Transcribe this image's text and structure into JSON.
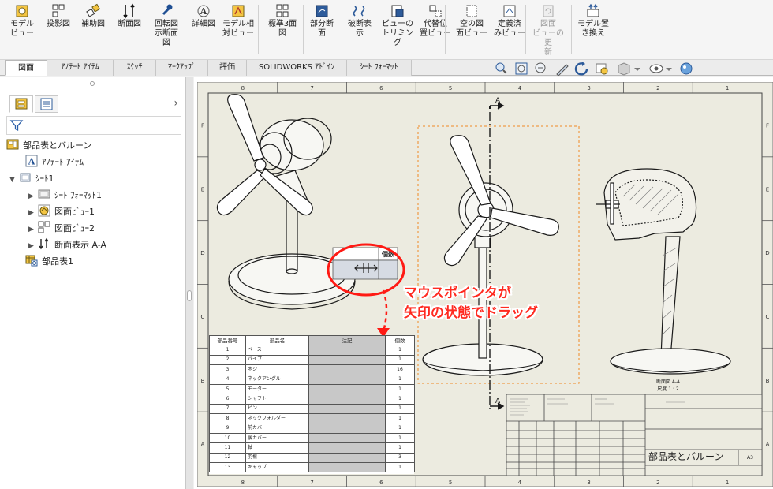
{
  "ribbon": {
    "buttons": [
      {
        "id": "model-view",
        "label": "モデル\nビュー",
        "icon": "model-view-icon",
        "disabled": false
      },
      {
        "id": "projected-view",
        "label": "投影図",
        "icon": "projected-view-icon",
        "disabled": false
      },
      {
        "id": "auxiliary-view",
        "label": "補助図",
        "icon": "auxiliary-view-icon",
        "disabled": false
      },
      {
        "id": "section-view",
        "label": "断面図",
        "icon": "section-view-icon",
        "disabled": false
      },
      {
        "id": "revolved-section",
        "label": "回転図\n示断面\n図",
        "icon": "revolved-section-icon",
        "disabled": false
      },
      {
        "id": "detail-view",
        "label": "詳細図",
        "icon": "detail-view-icon",
        "disabled": false
      },
      {
        "id": "relative-view",
        "label": "モデル相\n対ビュー",
        "icon": "relative-view-icon",
        "disabled": false
      },
      {
        "id": "standard-3-view",
        "label": "標準3面\n図",
        "icon": "standard-3-view-icon",
        "disabled": false
      },
      {
        "id": "broken-out-section",
        "label": "部分断\n面",
        "icon": "broken-out-section-icon",
        "disabled": false
      },
      {
        "id": "break-view",
        "label": "破断表\n示",
        "icon": "break-view-icon",
        "disabled": false
      },
      {
        "id": "crop-view",
        "label": "ビューの\nトリミング",
        "icon": "crop-view-icon",
        "disabled": false
      },
      {
        "id": "alternate-position",
        "label": "代替位\n置ビュー",
        "icon": "alternate-position-icon",
        "disabled": false
      },
      {
        "id": "empty-view",
        "label": "空の図\n面ビュー",
        "icon": "empty-view-icon",
        "disabled": false
      },
      {
        "id": "predefined-view",
        "label": "定義済\nみビュー",
        "icon": "predefined-view-icon",
        "disabled": false
      },
      {
        "id": "update-view",
        "label": "図面\nビューの更\n新",
        "icon": "update-view-icon",
        "disabled": true
      },
      {
        "id": "replace-model",
        "label": "モデル置\nき換え",
        "icon": "replace-model-icon",
        "disabled": false
      }
    ]
  },
  "tabs": [
    {
      "label": "図面",
      "active": true
    },
    {
      "label": "ｱﾉﾃｰﾄ ｱｲﾃﾑ",
      "active": false
    },
    {
      "label": "ｽｹｯﾁ",
      "active": false
    },
    {
      "label": "ﾏｰｸｱｯﾌﾟ",
      "active": false
    },
    {
      "label": "評価",
      "active": false
    },
    {
      "label": "SOLIDWORKS ｱﾄﾞｲﾝ",
      "active": false
    },
    {
      "label": "ｼｰﾄ ﾌｫｰﾏｯﾄ",
      "active": false
    }
  ],
  "view_tools": [
    "zoom-fit-icon",
    "zoom-area-icon",
    "zoom-in-out-icon",
    "select-icon",
    "rotate-icon",
    "previous-view-icon",
    "display-style-icon",
    "hide-show-icon",
    "appearance-icon"
  ],
  "tree": {
    "root": "部品表とバルーン",
    "annotations": "ｱﾉﾃｰﾄ ｱｲﾃﾑ",
    "sheet": "ｼｰﾄ1",
    "sheet_format": "ｼｰﾄ ﾌｫｰﾏｯﾄ1",
    "view1": "図面ﾋﾞｭｰ1",
    "view2": "図面ﾋﾞｭｰ2",
    "section": "断面表示 A-A",
    "bom": "部品表1"
  },
  "sheet": {
    "cols": [
      "8",
      "7",
      "6",
      "5",
      "4",
      "3",
      "2",
      "1"
    ],
    "rows": [
      "F",
      "E",
      "D",
      "C",
      "B",
      "A"
    ],
    "title": "部品表とバルーン",
    "size": "A3",
    "section_label": "A",
    "section_view_caption": "断面図 A-A",
    "section_view_scale": "尺度 1 : 2"
  },
  "bom": {
    "headers": [
      "部品番号",
      "部品名",
      "注記",
      "個数"
    ],
    "rows": [
      [
        "1",
        "ベース",
        "1"
      ],
      [
        "2",
        "パイプ",
        "1"
      ],
      [
        "3",
        "ネジ",
        "16"
      ],
      [
        "4",
        "ネックアングル",
        "1"
      ],
      [
        "5",
        "モーター",
        "1"
      ],
      [
        "6",
        "シャフト",
        "1"
      ],
      [
        "7",
        "ピン",
        "1"
      ],
      [
        "8",
        "ネックフォルダー",
        "1"
      ],
      [
        "9",
        "前カバー",
        "1"
      ],
      [
        "10",
        "後カバー",
        "1"
      ],
      [
        "11",
        "軸",
        "1"
      ],
      [
        "12",
        "羽根",
        "3"
      ],
      [
        "13",
        "キャップ",
        "1"
      ]
    ],
    "zoom_header_fragment": "個数"
  },
  "annotation": {
    "line1": "マウスポインタが",
    "line2": "矢印の状態でドラッグ"
  },
  "colors": {
    "annotation_red": "#ff2a20",
    "sheet_bg": "#ecebe0",
    "selection_orange": "#f08a24"
  }
}
